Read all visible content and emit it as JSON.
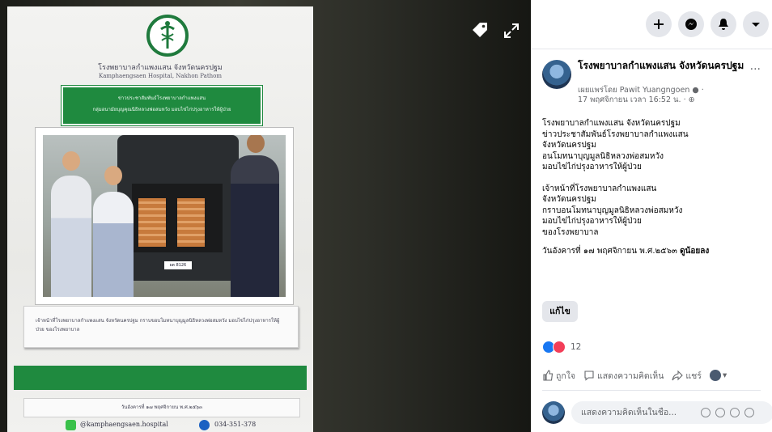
{
  "poster": {
    "hospital_th": "โรงพยาบาลกำแพงแสน จังหวัดนครปฐม",
    "hospital_en": "Kamphaengsaen Hospital, Nakhon Pathom",
    "banner_line1": "ข่าวประชาสัมพันธ์โรงพยาบาลกำแพงแสน",
    "banner_line2": "กลุ่มอนามัยบุญคุณนิธิหลวงพ่อสมหวัง มอบไข่ไก่ปรุงอาหารให้ผู้ป่วย",
    "plate": "ผต 8126",
    "caption": "เจ้าหน้าที่โรงพยาบาลกำแพงแสน จังหวัดนครปฐม กราบขอบโมทนาบุญมูลนิธิหลวงพ่อสมหวัง มอบไข่ไก่ปรุงอาหารให้ผู้ป่วย ของโรงพยาบาล",
    "date": "วันอังคารที่ ๑๗ พฤศจิกายน พ.ศ.๒๕๖๓",
    "line_id": "@kamphaengsaen.hospital",
    "phone": "034-351-378"
  },
  "viewer": {
    "tag_icon": "tag-icon",
    "expand_icon": "expand-icon"
  },
  "topbar": {
    "icons": [
      "plus-icon",
      "messenger-icon",
      "bell-icon",
      "caret-down-icon"
    ]
  },
  "post": {
    "page_name": "โรงพยาบาลกำแพงแสน จังหวัดนครปฐม",
    "posted_by": "เผยแพร่โดย Pawit Yuangngoen",
    "timestamp": "17 พฤศจิกายน เวลา 16:52 น. ·",
    "more": "···",
    "body_lines_1": [
      "โรงพยาบาลกำแพงแสน จังหวัดนครปฐม",
      "ข่าวประชาสัมพันธ์โรงพยาบาลกำแพงแสน",
      "จังหวัดนครปฐม",
      "อนโมทนาบุญมูลนิธิหลวงพ่อสมหวัง",
      "มอบไข่ไก่ปรุงอาหารให้ผู้ป่วย"
    ],
    "body_lines_2": [
      "เจ้าหน้าที่โรงพยาบาลกำแพงแสน",
      "จังหวัดนครปฐม",
      "กราบอนโมทนาบุญมูลนิธิหลวงพ่อสมหวัง",
      "มอบไข่ไก่ปรุงอาหารให้ผู้ป่วย",
      "ของโรงพยาบาล"
    ],
    "date_line": "วันอังคารที่ ๑๗ พฤศจิกายน พ.ศ.๒๕๖๓",
    "see_more": "ดูน้อยลง",
    "edit_button": "แก้ไข",
    "reaction_count": "12",
    "like_label": "ถูกใจ",
    "comment_label": "แสดงความคิดเห็น",
    "share_label": "แชร์",
    "comment_placeholder": "แสดงความคิดเห็นในชื่อ..."
  },
  "colors": {
    "poster_green": "#1f8a3f",
    "fb_blue": "#1877f2",
    "love_red": "#f33e58"
  }
}
